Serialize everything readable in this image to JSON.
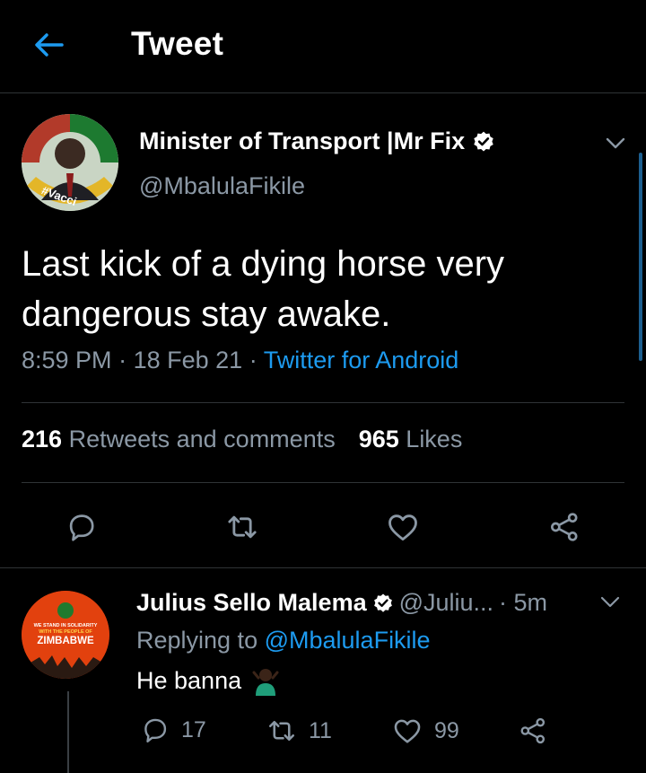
{
  "header": {
    "title": "Tweet",
    "back_icon": "arrow-left-icon"
  },
  "tweet": {
    "author_name": "Minister of Transport |Mr Fix",
    "author_handle": "@MbalulaFikile",
    "text": "Last kick of a dying horse very dangerous stay awake.",
    "time": "8:59 PM",
    "date": "18 Feb 21",
    "sep": "·",
    "source": "Twitter for Android",
    "retweets_count": "216",
    "retweets_label": "Retweets and comments",
    "likes_count": "965",
    "likes_label": "Likes",
    "avatar_text": "#Vacci"
  },
  "reply": {
    "author_name": "Julius Sello Malema",
    "author_handle": "@Juliu...",
    "time": "· 5m",
    "replying_prefix": "Replying to",
    "replying_handle": "@MbalulaFikile",
    "text": "He banna",
    "reply_count": "17",
    "retweet_count": "11",
    "like_count": "99",
    "avatar_lines": [
      "WE STAND IN SOLIDARITY",
      "WITH THE PEOPLE OF",
      "ZIMBABWE"
    ]
  },
  "colors": {
    "accent": "#1d9bf0",
    "muted": "#8b98a5",
    "background": "#000000"
  }
}
